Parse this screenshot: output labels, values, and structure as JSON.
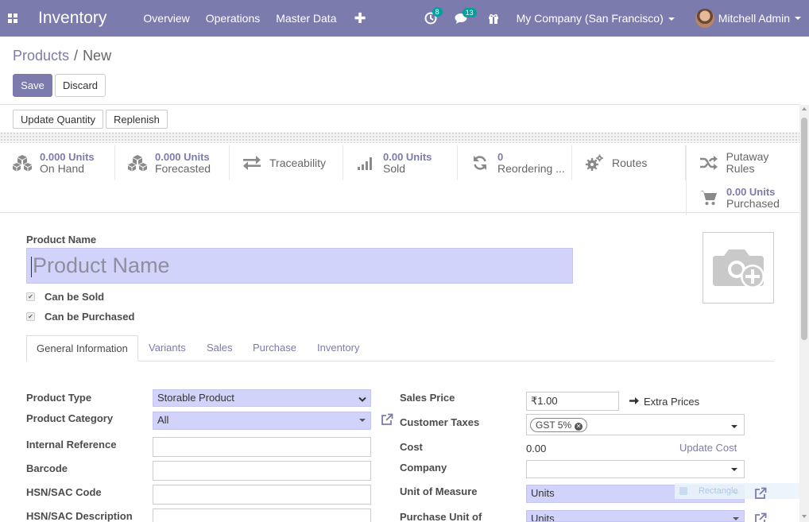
{
  "navbar": {
    "app_title": "Inventory",
    "menu": [
      "Overview",
      "Operations",
      "Master Data"
    ],
    "activity_badge": "8",
    "messages_badge": "13",
    "company": "My Company (San Francisco)",
    "user": "Mitchell Admin",
    "accent_color": "#7c7bad"
  },
  "breadcrumb": {
    "parent": "Products",
    "separator": "/",
    "current": "New"
  },
  "actions": {
    "save": "Save",
    "discard": "Discard"
  },
  "statusbar": {
    "update_quantity": "Update Quantity",
    "replenish": "Replenish"
  },
  "smart_buttons": {
    "on_hand": {
      "value": "0.000 Units",
      "label": "On Hand",
      "icon": "cubes-icon"
    },
    "forecasted": {
      "value": "0.000 Units",
      "label": "Forecasted",
      "icon": "cubes-icon"
    },
    "traceability": {
      "label": "Traceability",
      "icon": "exchange-icon"
    },
    "sold": {
      "value": "0.00 Units",
      "label": "Sold",
      "icon": "signal-icon"
    },
    "reordering": {
      "value": "0",
      "label": "Reordering ...",
      "icon": "refresh-icon"
    },
    "routes": {
      "label": "Routes",
      "icon": "cogs-icon"
    },
    "putaway": {
      "label": "Putaway Rules",
      "icon": "random-icon"
    },
    "purchased": {
      "value": "0.00 Units",
      "label": "Purchased",
      "icon": "cart-icon"
    }
  },
  "form": {
    "product_name_label": "Product Name",
    "product_name_placeholder": "Product Name",
    "can_be_sold": "Can be Sold",
    "can_be_purchased": "Can be Purchased",
    "tabs": [
      "General Information",
      "Variants",
      "Sales",
      "Purchase",
      "Inventory"
    ],
    "left_fields": {
      "product_type_label": "Product Type",
      "product_type_value": "Storable Product",
      "product_category_label": "Product Category",
      "product_category_value": "All",
      "internal_reference_label": "Internal Reference",
      "barcode_label": "Barcode",
      "hsn_code_label": "HSN/SAC Code",
      "hsn_desc_label": "HSN/SAC Description"
    },
    "right_fields": {
      "sales_price_label": "Sales Price",
      "sales_price_value": "₹1.00",
      "extra_prices": "Extra Prices",
      "customer_taxes_label": "Customer Taxes",
      "tax_tag": "GST 5%",
      "cost_label": "Cost",
      "cost_value": "0.00",
      "update_cost": "Update Cost",
      "company_label": "Company",
      "uom_label": "Unit of Measure",
      "uom_value": "Units",
      "purchase_uom_label": "Purchase Unit of",
      "purchase_uom_value": "Units"
    },
    "ghost_label": "Rectangle"
  }
}
